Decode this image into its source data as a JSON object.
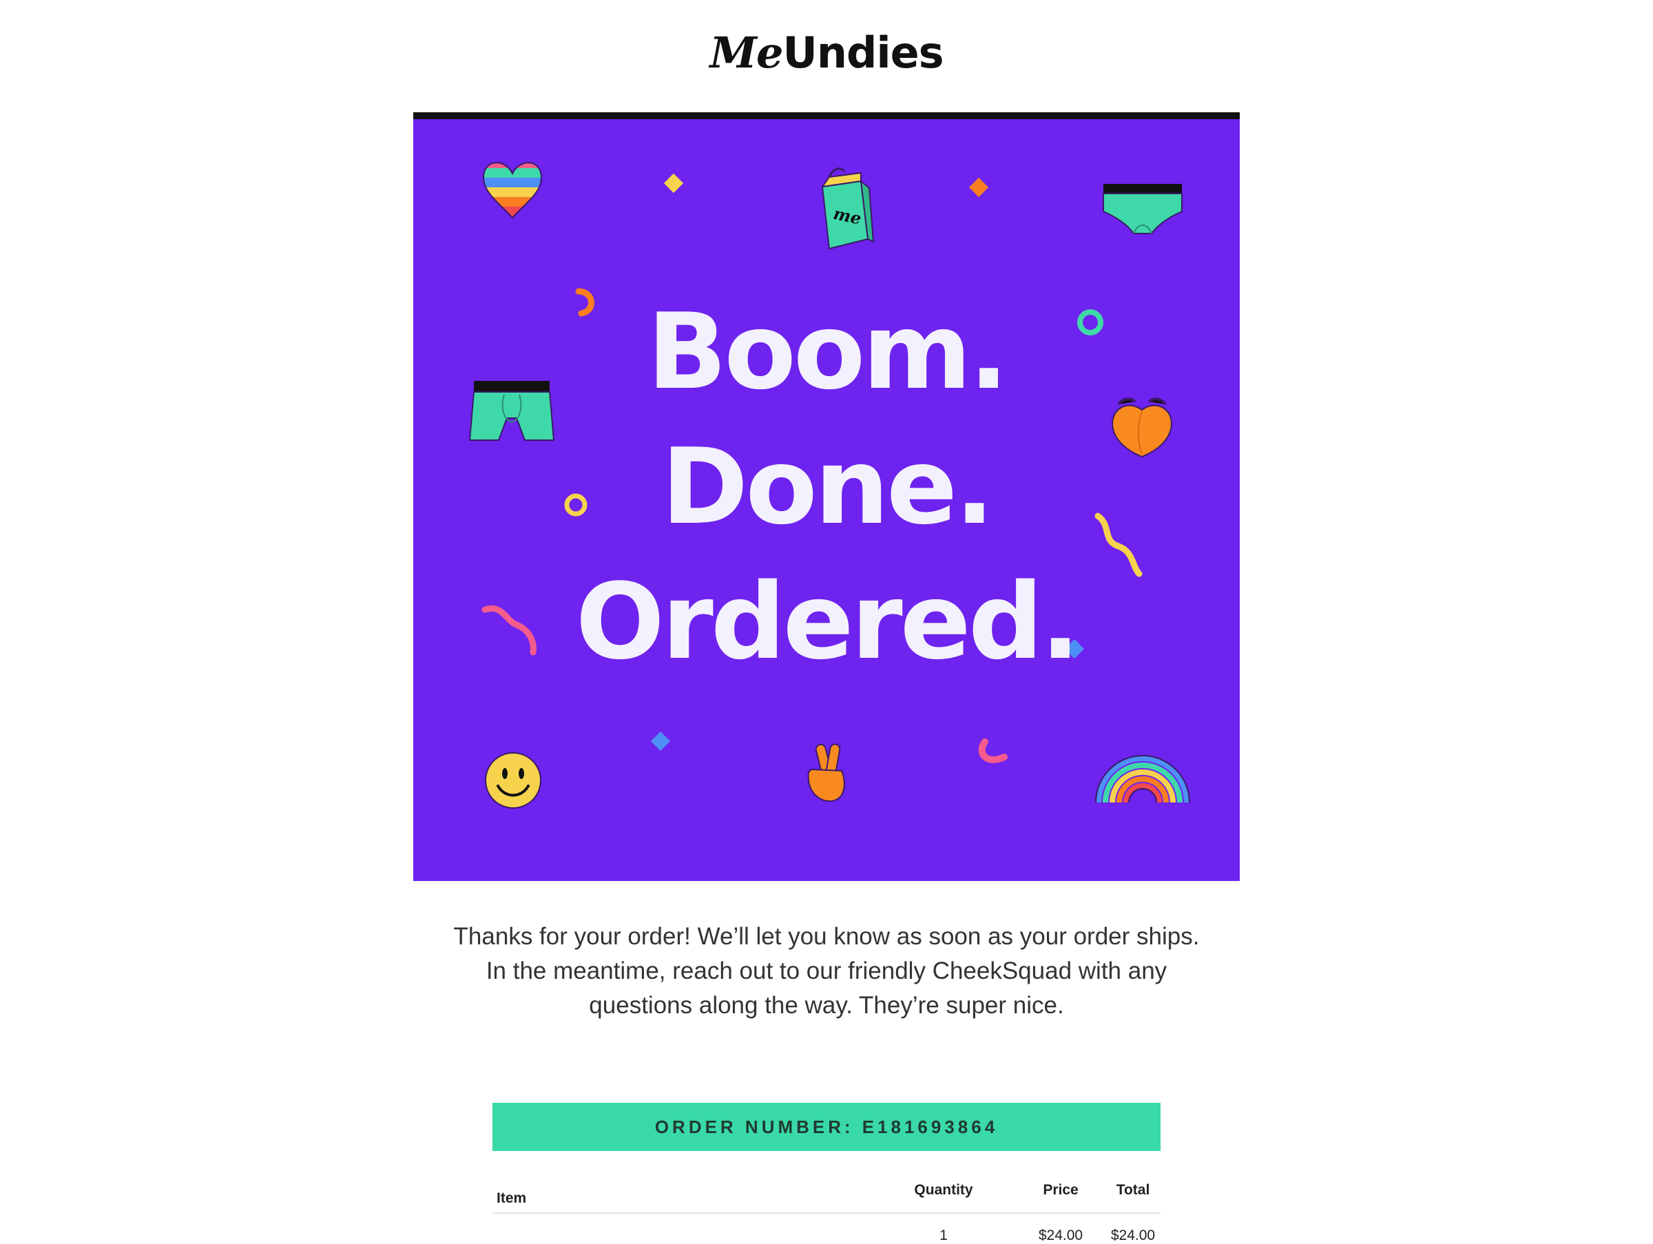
{
  "brand": {
    "logo_me": "Me",
    "logo_rest": "Undies"
  },
  "hero": {
    "line1": "Boom.",
    "line2": "Done.",
    "line3": "Ordered.",
    "bag_mark": "me",
    "background_color": "#6e23ee",
    "icons": [
      "rainbow-heart-icon",
      "shopping-bag-icon",
      "briefs-icon",
      "boxer-briefs-icon",
      "peach-icon",
      "smiley-icon",
      "peace-sign-icon",
      "rainbow-icon"
    ]
  },
  "message": {
    "line1": "Thanks for your order! We’ll let you know as soon as your order ships.",
    "line2": "In the meantime, reach out to our friendly CheekSquad with any",
    "line3": "questions along the way. They’re super nice."
  },
  "order": {
    "label": "ORDER NUMBER:",
    "number": "E181693864",
    "accent_color": "#39d9a8"
  },
  "table": {
    "headers": {
      "item": "Item",
      "quantity": "Quantity",
      "price": "Price",
      "total": "Total"
    },
    "rows": [
      {
        "item": "",
        "quantity": "1",
        "price": "$24.00",
        "total": "$24.00"
      }
    ]
  }
}
